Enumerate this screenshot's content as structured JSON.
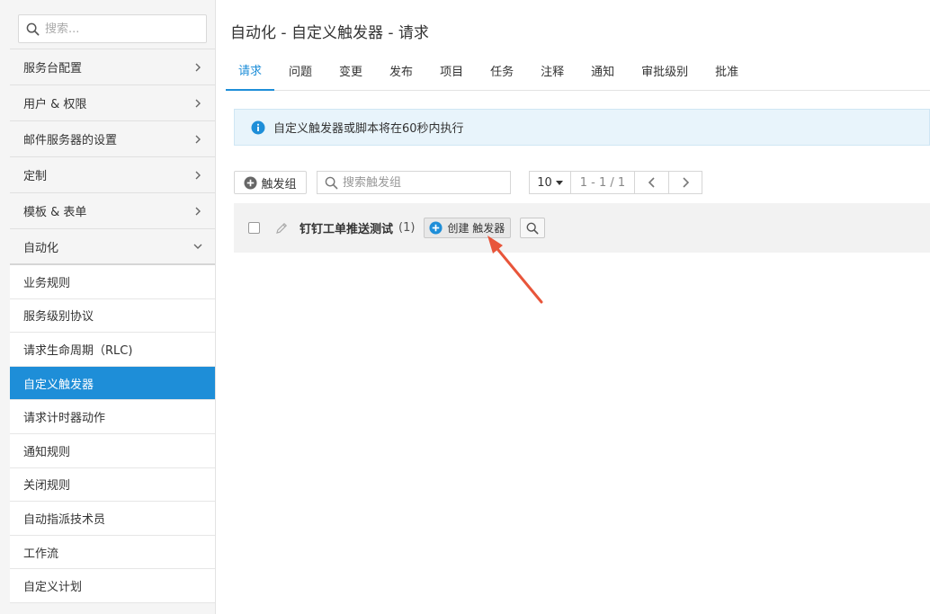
{
  "sidebar": {
    "search_placeholder": "搜索...",
    "items": [
      {
        "label": "服务台配置"
      },
      {
        "label": "用户 & 权限"
      },
      {
        "label": "邮件服务器的设置"
      },
      {
        "label": "定制"
      },
      {
        "label": "模板 & 表单"
      },
      {
        "label": "自动化"
      }
    ],
    "sub_items": [
      {
        "label": "业务规则"
      },
      {
        "label": "服务级别协议"
      },
      {
        "label": "请求生命周期（RLC)"
      },
      {
        "label": "自定义触发器"
      },
      {
        "label": "请求计时器动作"
      },
      {
        "label": "通知规则"
      },
      {
        "label": "关闭规则"
      },
      {
        "label": "自动指派技术员"
      },
      {
        "label": "工作流"
      },
      {
        "label": "自定义计划"
      }
    ]
  },
  "main": {
    "title": "自动化 - 自定义触发器 - 请求",
    "tabs": [
      {
        "label": "请求"
      },
      {
        "label": "问题"
      },
      {
        "label": "变更"
      },
      {
        "label": "发布"
      },
      {
        "label": "项目"
      },
      {
        "label": "任务"
      },
      {
        "label": "注释"
      },
      {
        "label": "通知"
      },
      {
        "label": "审批级别"
      },
      {
        "label": "批准"
      }
    ],
    "info_text": "自定义触发器或脚本将在60秒内执行",
    "toolbar": {
      "add_group_label": "触发组",
      "search_placeholder": "搜索触发组",
      "page_size": "10",
      "page_range": "1 - 1 / 1"
    },
    "group": {
      "name": "钉钉工单推送测试",
      "count": "(1)",
      "create_label": "创建 触发器"
    }
  },
  "colors": {
    "accent": "#1e8ed8",
    "info_bg": "#e8f4fb",
    "annotation_arrow": "#e8553a"
  }
}
